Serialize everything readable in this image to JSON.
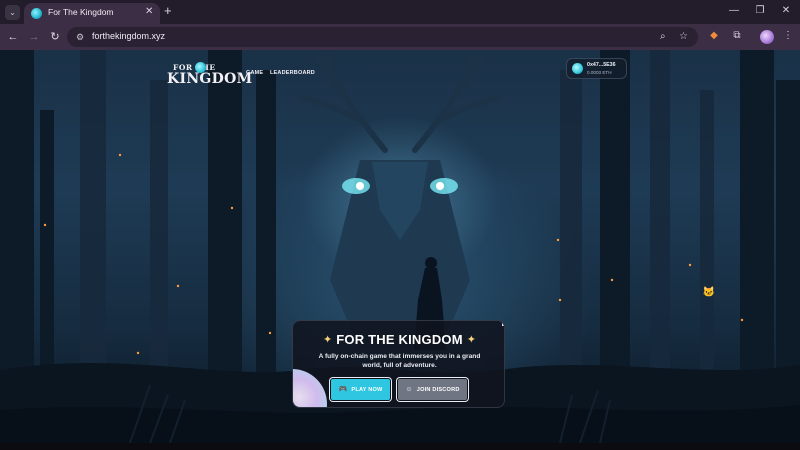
{
  "browser": {
    "tab_title": "For The Kingdom",
    "url": "forthekingdom.xyz",
    "icons": {
      "tab_menu": "chevron-down-icon",
      "close_tab": "close-icon",
      "new_tab": "plus-icon",
      "minimize": "minimize-icon",
      "maximize": "maximize-icon",
      "close_window": "close-icon",
      "back": "arrow-left-icon",
      "forward": "arrow-right-icon",
      "reload": "reload-icon",
      "site_info": "tune-icon",
      "zoom": "search-icon",
      "bookmark": "star-icon",
      "extension_fox": "fox-icon",
      "extensions": "puzzle-icon",
      "profile": "avatar"
    }
  },
  "site": {
    "logo": {
      "top": "FOR THE",
      "bottom": "KINGDOM"
    },
    "nav": [
      {
        "label": "GAME"
      },
      {
        "label": "LEADERBOARD"
      }
    ],
    "wallet": {
      "address": "0x47...5E36",
      "balance": "0.0003 ETH"
    },
    "hero": {
      "title": "FOR THE KINGDOM",
      "subtitle": "A fully on-chain game that immerses you in a grand world, full of adventure.",
      "play_button": "PLAY NOW",
      "discord_button": "JOIN DISCORD"
    }
  },
  "colors": {
    "tab_bar": "#231c2b",
    "toolbar": "#3b2e45",
    "accent_cyan": "#2ec6e0",
    "button_gray": "#6f7582",
    "card_bg": "#10141e",
    "sparkle": "#f6d27a"
  }
}
